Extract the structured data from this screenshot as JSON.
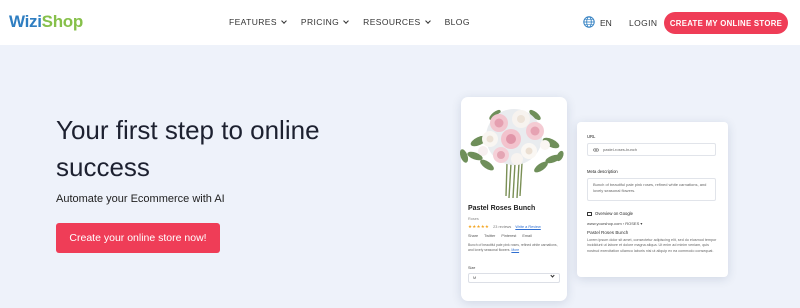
{
  "header": {
    "logo_part1": "Wizi",
    "logo_part2": "Shop",
    "nav": [
      {
        "label": "FEATURES",
        "has_dropdown": true
      },
      {
        "label": "PRICING",
        "has_dropdown": true
      },
      {
        "label": "RESOURCES",
        "has_dropdown": true
      },
      {
        "label": "BLOG",
        "has_dropdown": false
      }
    ],
    "language": "EN",
    "login": "LOGIN",
    "cta": "CREATE MY ONLINE STORE"
  },
  "hero": {
    "title": "Your first step to online success",
    "subtitle": "Automate your Ecommerce with AI",
    "button": "Create your online store now!"
  },
  "product": {
    "title": "Pastel Roses Bunch",
    "label": "Roses",
    "stars": "★★★★★",
    "reviews": "23 reviews",
    "write_review": "Write a Review",
    "share": [
      "Share",
      "Twitter",
      "Pinterest",
      "Email"
    ],
    "description": "Bunch of beautiful pale pink roses, refined white carnations, and lovely seasonal flowers.",
    "more": "More",
    "size_label": "Size",
    "size_value": "M"
  },
  "seo": {
    "url_label": "URL",
    "url_value": "pastel-roses-bunch",
    "meta_label": "Meta description",
    "meta_value": "Bunch of beautiful pale pink roses, refined white carnations, and lovely seasonal flowers.",
    "google_label": "Overview on Google",
    "google_url": "www.yourshop.com › ROSES ▾",
    "google_title": "Pastel Roses Bunch",
    "google_desc": "Lorem ipsum dolor sit amet, consectetur adipiscing elit, sed do eiusmod tempor incididunt ut labore et dolore magna aliqua. Ut enim ad minim veniam, quis nostrud exercitation ullamco laboris nisi ut aliquip ex ea commodo consequat."
  },
  "colors": {
    "accent": "#ef3d57",
    "background": "#eef2fa",
    "logo_blue": "#2f7ec1",
    "logo_green": "#86c04a"
  },
  "icons": [
    "globe-icon",
    "chevron-down-icon",
    "link-icon",
    "monitor-icon",
    "star-icon"
  ]
}
